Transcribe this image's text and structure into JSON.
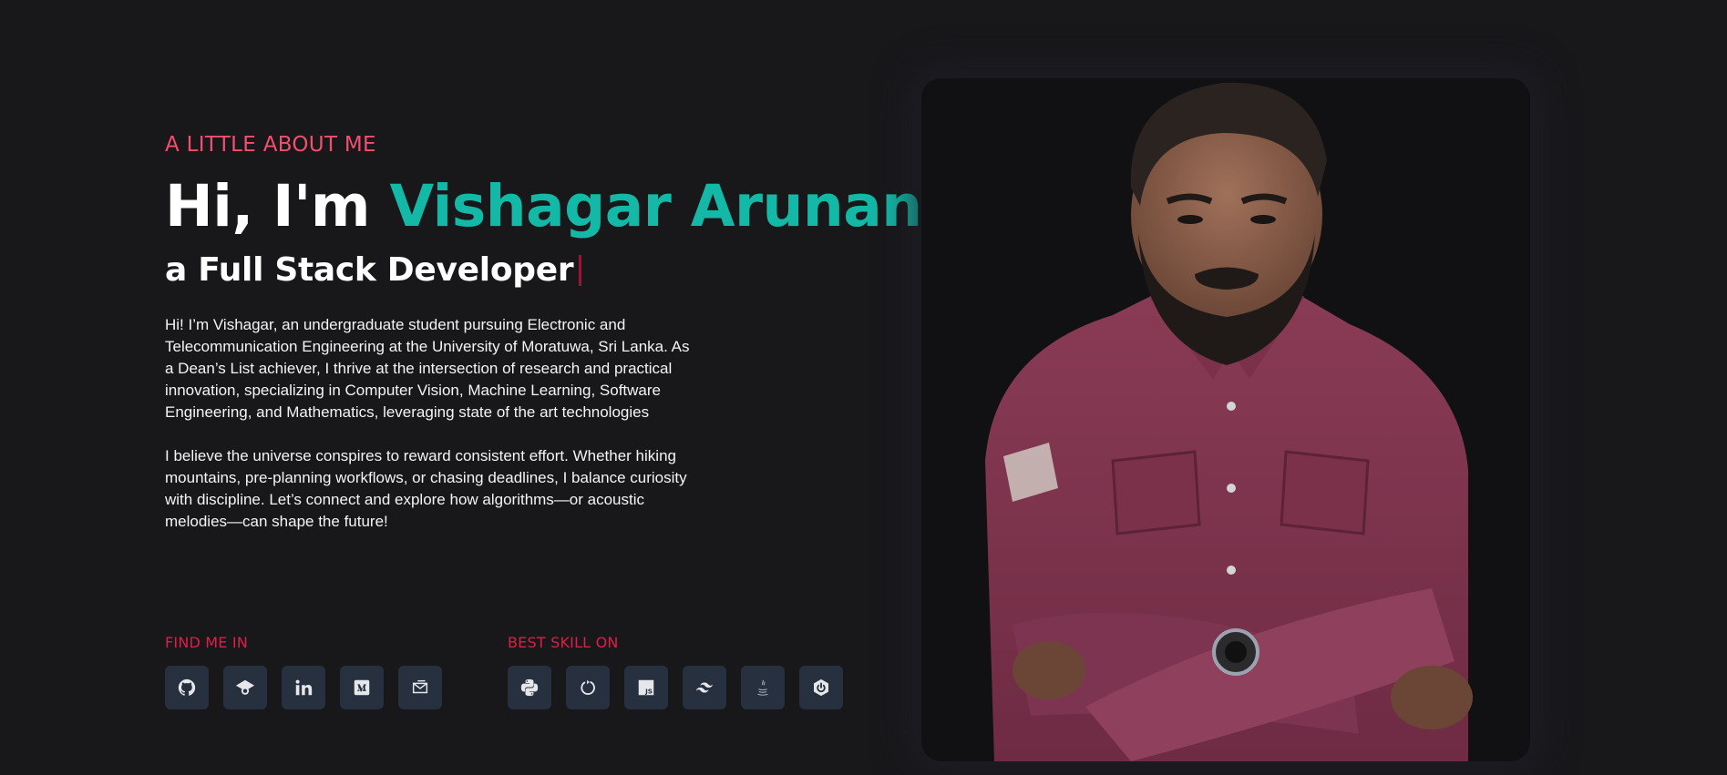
{
  "about": {
    "kicker": "A LITTLE ABOUT ME",
    "greeting": "Hi, I'm ",
    "name": "Vishagar Arunan",
    "role": "a Full Stack Developer",
    "bio": [
      "Hi! I’m Vishagar, an undergraduate student pursuing Electronic and Telecommunication Engineering at the University of Moratuwa, Sri Lanka. As a Dean’s List achiever, I thrive at the intersection of research and practical innovation, specializing in Computer Vision, Machine Learning, Software Engineering, and Mathematics, leveraging state of the art technologies",
      "I believe the universe conspires to reward consistent effort. Whether hiking mountains, pre-planning workflows, or chasing deadlines, I balance curiosity with discipline. Let’s connect and explore how algorithms—or acoustic melodies—can shape the future!"
    ]
  },
  "social": {
    "title": "FIND ME IN",
    "icons": [
      "github-icon",
      "graduation-cap-icon",
      "linkedin-icon",
      "medium-icon",
      "email-icon"
    ]
  },
  "skills": {
    "title": "BEST SKILL ON",
    "icons": [
      "python-icon",
      "react-loop-icon",
      "javascript-icon",
      "tailwind-icon",
      "java-icon",
      "spring-boot-icon"
    ]
  },
  "colors": {
    "background": "#18181b",
    "kicker": "#f0506e",
    "name_accent": "#14b8a6",
    "section_title": "#e11d48",
    "icon_button": "#27303f",
    "cursor": "#9f1239"
  },
  "photo": {
    "subject": "portrait-photo"
  }
}
